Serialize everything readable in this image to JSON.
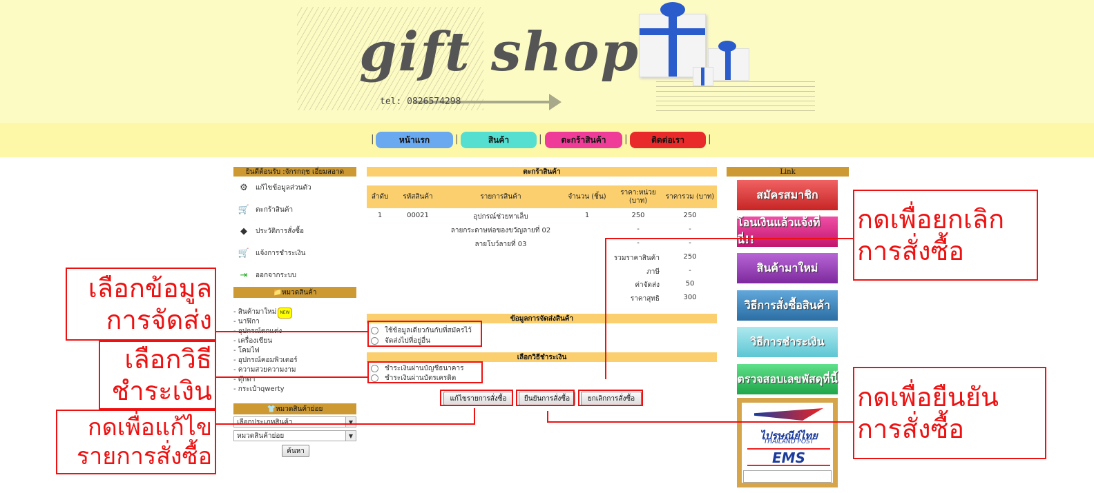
{
  "header": {
    "logo": "gift shop",
    "tel": "tel: 0826574298"
  },
  "nav": [
    {
      "label": "หน้าแรก",
      "color": "#6aa8ef"
    },
    {
      "label": "สินค้า",
      "color": "#55dfd0"
    },
    {
      "label": "ตะกร้าสินค้า",
      "color": "#ef3c98"
    },
    {
      "label": "ติดต่อเรา",
      "color": "#e82a2a"
    }
  ],
  "sidebar": {
    "welcome": "ยินดีต้อนรับ :จักรกฤช เอี่ยมสอาด",
    "menu": [
      {
        "label": "แก้ไขข้อมูลส่วนตัว",
        "icon": "gear-icon"
      },
      {
        "label": "ตะกร้าสินค้า",
        "icon": "cart-icon"
      },
      {
        "label": "ประวัติการสั่งซื้อ",
        "icon": "history-icon"
      },
      {
        "label": "แจ้งการชำระเงิน",
        "icon": "payment-icon"
      },
      {
        "label": "ออกจากระบบ",
        "icon": "logout-icon"
      }
    ],
    "category_title": "หมวดสินค้า",
    "categories": [
      "- สินค้ามาใหม่",
      "- นาฬิกา",
      "- อุปกรณ์ตกแต่ง",
      "- เครื่องเขียน",
      "- โคมไฟ",
      "- อุปกรณ์คอมพิวเตอร์",
      "- ความสวยความงาม",
      "- ตุ๊กตา",
      "- กระเป๋าqwerty"
    ],
    "new_badge": "NEW",
    "subcategory_title": "หมวดสินค้าย่อย",
    "select1": "เลือกประเภทสินค้า",
    "select2": "หมวดสินค้าย่อย",
    "search_button": "ค้นหา"
  },
  "cart": {
    "title": "ตะกร้าสินค้า",
    "columns": [
      "ลำดับ",
      "รหัสสินค้า",
      "รายการสินค้า",
      "จำนวน (ชิ้น)",
      "ราคา:หน่วย (บาท)",
      "ราคารวม (บาท)"
    ],
    "rows": [
      [
        "1",
        "00021",
        "อุปกรณ์ช่วยทาเล็บ",
        "1",
        "250",
        "250"
      ],
      [
        "",
        "",
        "ลายกระดาษห่อของขวัญลายที่ 02",
        "",
        "-",
        "-"
      ],
      [
        "",
        "",
        "ลายโบว์ลายที่ 03",
        "",
        "-",
        "-"
      ]
    ],
    "summary": [
      {
        "label": "รวมราคาสินค้า",
        "value": "250"
      },
      {
        "label": "ภาษี",
        "value": "-"
      },
      {
        "label": "ค่าจัดส่ง",
        "value": "50"
      },
      {
        "label": "ราคาสุทธิ",
        "value": "300"
      }
    ],
    "shipping_title": "ข้อมูลการจัดส่งสินค้า",
    "shipping_options": [
      "ใช้ข้อมูลเดียวกันกับที่สมัครไว้",
      "จัดส่งไปที่อยู่อื่น"
    ],
    "payment_title": "เลือกวิธีชำระเงิน",
    "payment_options": [
      "ชำระเงินผ่านบัญชีธนาคาร",
      "ชำระเงินผ่านบัตรเครดิต"
    ],
    "buttons": {
      "edit": "แก้ไขรายการสั่งซื้อ",
      "confirm": "ยืนยันการสั่งซื้อ",
      "cancel": "ยกเลิกการสั่งซื้อ"
    }
  },
  "links": {
    "title": "Link",
    "banners": [
      {
        "label": "สมัครสมาชิก",
        "color": "#e33b3b"
      },
      {
        "label": "โอนเงินแล้วแจ้งที่นี่!!",
        "color": "#e3308e"
      },
      {
        "label": "สินค้ามาใหม่",
        "color": "#9b3fb8"
      },
      {
        "label": "วิธีการสั่งซื้อสินค้า",
        "color": "#3d8fc7"
      },
      {
        "label": "วิธีการชำระเงิน",
        "color": "#7fd7e0"
      },
      {
        "label": "ตรวจสอบเลขพัสดุที่นี้",
        "color": "#3cc76a"
      }
    ],
    "post_name": "ไปรษณีย์ไทย",
    "post_name_en": "THAILAND POST",
    "ems": "EMS"
  },
  "annotations": {
    "cancel": [
      "กดเพื่อยกเลิก",
      "การสั่งซื้อ"
    ],
    "confirm": [
      "กดเพื่อยืนยัน",
      "การสั่งซื้อ"
    ],
    "shipping": [
      "เลือกข้อมูล",
      "การจัดส่ง"
    ],
    "payment": [
      "เลือกวิธี",
      "ชำระเงิน"
    ],
    "edit": [
      "กดเพื่อแก้ไข",
      "รายการสั่งซื้อ"
    ]
  }
}
